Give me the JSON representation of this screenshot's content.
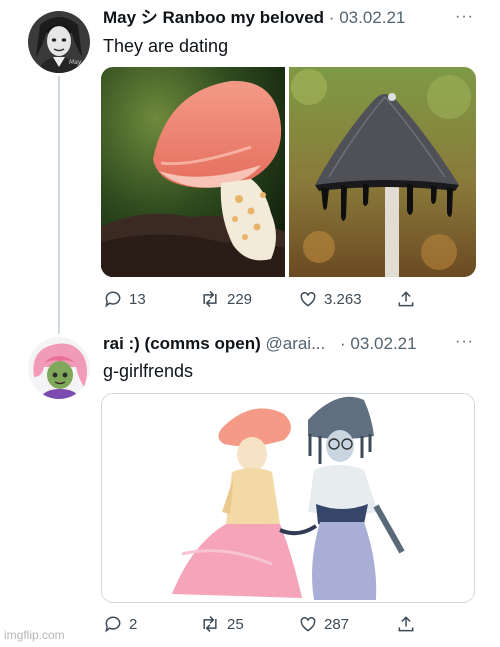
{
  "tweets": [
    {
      "display_name": "May シ Ranboo my beloved",
      "separator": "·",
      "date": "03.02.21",
      "text": "They are dating",
      "avatar_icon": "avatar-sketch-portrait",
      "avatar_signature": "May",
      "more_label": "···",
      "counts": {
        "replies": "13",
        "retweets": "229",
        "likes": "3.263"
      }
    },
    {
      "display_name": "rai :) (comms open)",
      "handle": "@arai...",
      "separator": "·",
      "date": "03.02.21",
      "text": "g-girlfrends",
      "avatar_icon": "avatar-pink-hair-character",
      "more_label": "···",
      "counts": {
        "replies": "2",
        "retweets": "25",
        "likes": "287"
      }
    }
  ],
  "icons": [
    "reply-icon",
    "retweet-icon",
    "like-icon",
    "share-icon",
    "more-icon"
  ],
  "colors": {
    "text": "#0f1419",
    "muted": "#536471",
    "thread_line": "#cfd9de",
    "border": "#cfd9de"
  },
  "watermark": "imgflip.com"
}
